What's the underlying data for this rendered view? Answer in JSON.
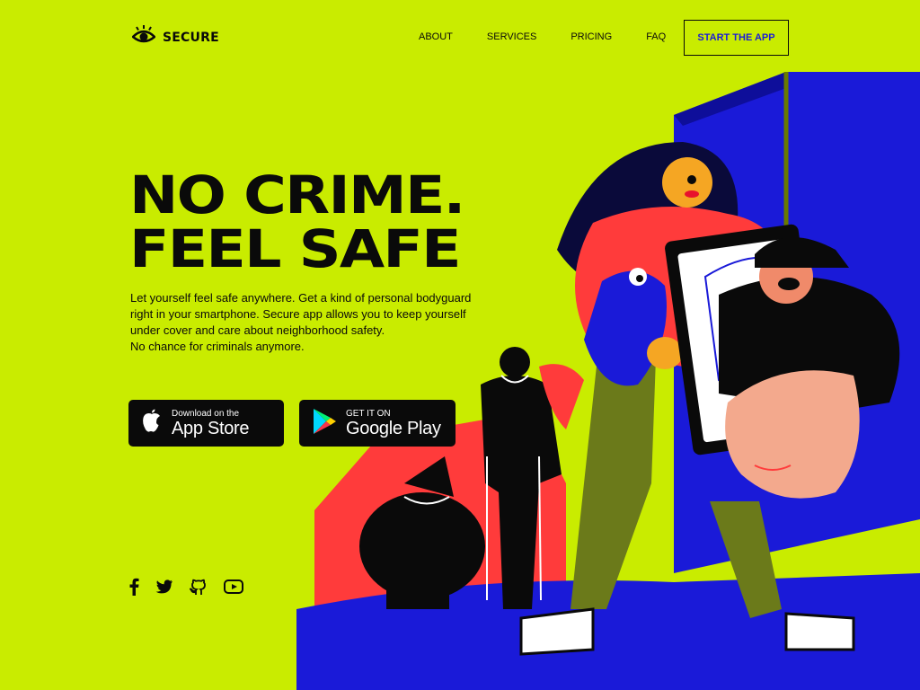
{
  "brand": {
    "name": "SECURE",
    "icon": "eye-icon"
  },
  "nav": {
    "items": [
      "ABOUT",
      "SERVICES",
      "PRICING",
      "FAQ"
    ],
    "cta": "START THE APP"
  },
  "hero": {
    "headline_line1": "NO CRIME.",
    "headline_line2": "FEEL SAFE",
    "description": [
      "Let yourself feel safe anywhere. Get a kind of personal bodyguard",
      "right in your smartphone. Secure app allows you to keep yourself",
      "under cover and care about neighborhood safety.",
      "No chance for criminals anymore."
    ]
  },
  "stores": {
    "apple": {
      "small": "Download on the",
      "big": "App Store",
      "icon": "apple-icon"
    },
    "google": {
      "small": "GET IT ON",
      "big": "Google Play",
      "icon": "google-play-icon"
    }
  },
  "social": [
    "facebook-icon",
    "twitter-icon",
    "github-icon",
    "youtube-icon"
  ],
  "colors": {
    "background": "#c9ec00",
    "accent_blue": "#1a1ad8",
    "accent_red": "#ff3b3b",
    "text": "#0a0a0a"
  }
}
